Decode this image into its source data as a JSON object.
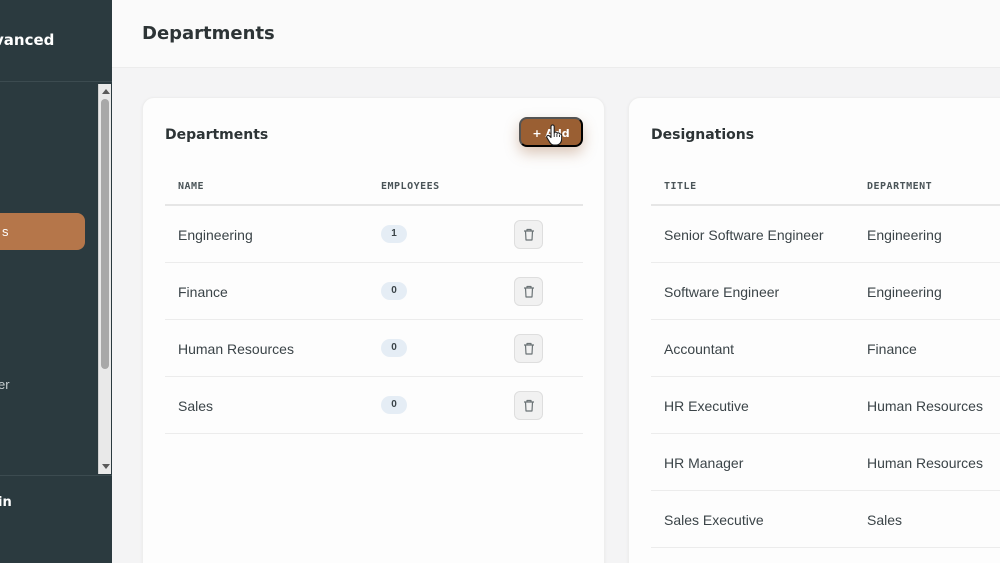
{
  "sidebar": {
    "brand": "vanced",
    "active_item": "s",
    "partial_item": "er",
    "footer_label": "in"
  },
  "header": {
    "title": "Departments"
  },
  "departments": {
    "title": "Departments",
    "add_label": "+ Add",
    "columns": [
      "NAME",
      "EMPLOYEES"
    ],
    "rows": [
      {
        "name": "Engineering",
        "employees": "1"
      },
      {
        "name": "Finance",
        "employees": "0"
      },
      {
        "name": "Human Resources",
        "employees": "0"
      },
      {
        "name": "Sales",
        "employees": "0"
      }
    ]
  },
  "designations": {
    "title": "Designations",
    "columns": [
      "TITLE",
      "DEPARTMENT"
    ],
    "rows": [
      {
        "title": "Senior Software Engineer",
        "department": "Engineering"
      },
      {
        "title": "Software Engineer",
        "department": "Engineering"
      },
      {
        "title": "Accountant",
        "department": "Finance"
      },
      {
        "title": "HR Executive",
        "department": "Human Resources"
      },
      {
        "title": "HR Manager",
        "department": "Human Resources"
      },
      {
        "title": "Sales Executive",
        "department": "Sales"
      }
    ]
  },
  "colors": {
    "sidebar_bg": "#2b3a3f",
    "accent": "#b5764a",
    "add_button": "#9a5f33",
    "badge_bg": "#e5edf5"
  },
  "icons": {
    "delete": "trash-icon",
    "cursor": "hand-pointer-icon",
    "scroll_up": "arrow-up-icon",
    "scroll_down": "arrow-down-icon"
  }
}
